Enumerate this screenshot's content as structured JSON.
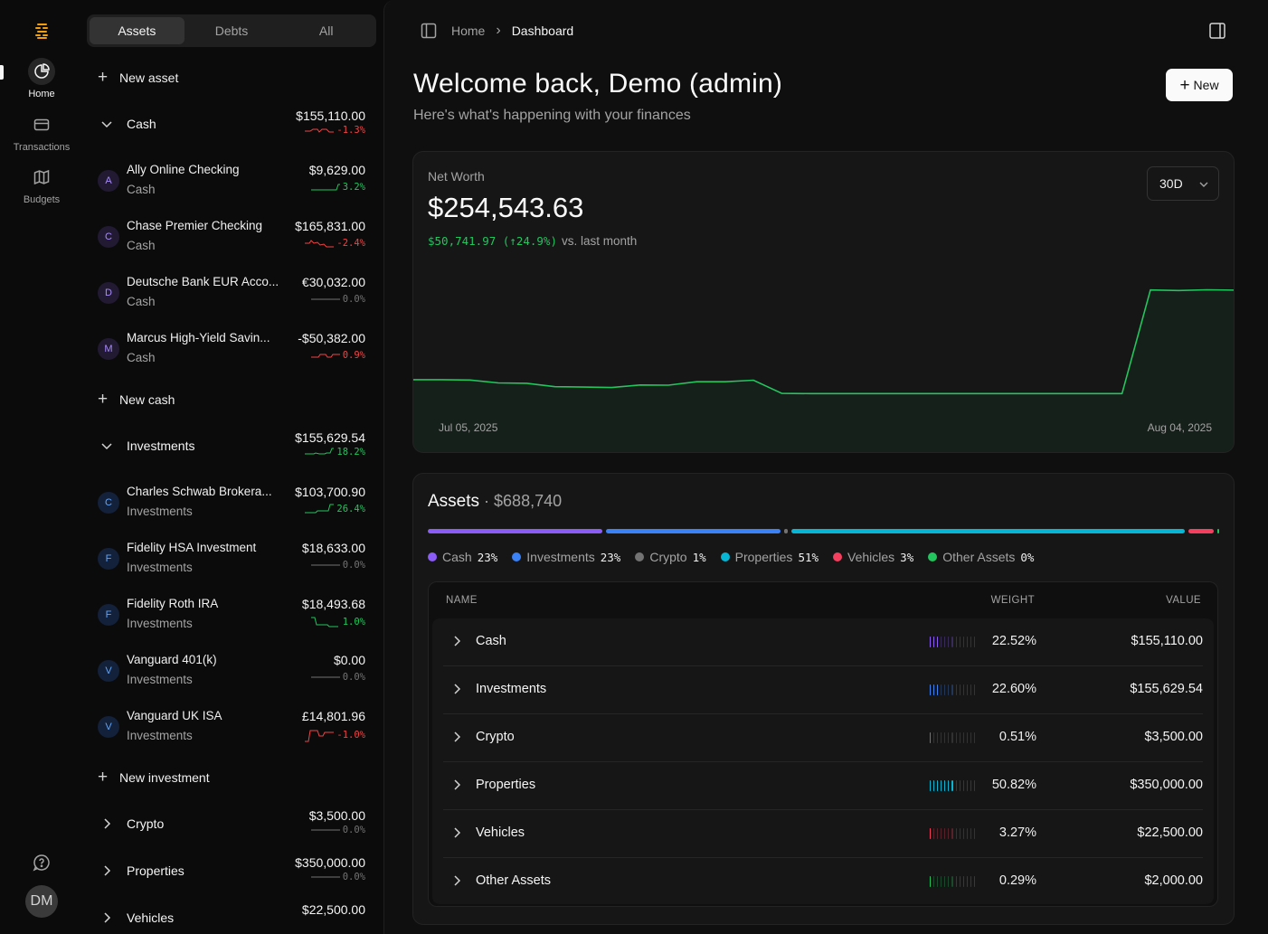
{
  "nav": {
    "items": [
      {
        "label": "Home",
        "icon": "pie-chart-icon",
        "active": true
      },
      {
        "label": "Transactions",
        "icon": "credit-card-icon",
        "active": false
      },
      {
        "label": "Budgets",
        "icon": "map-icon",
        "active": false
      }
    ],
    "user_initials": "DM"
  },
  "sidebar": {
    "tabs": [
      "Assets",
      "Debts",
      "All"
    ],
    "active_tab": "Assets",
    "new_asset": "New asset",
    "groups": {
      "cash": {
        "name": "Cash",
        "amount": "$155,110.00",
        "change": "-1.3%",
        "trend": "neg",
        "accounts": [
          {
            "initial": "A",
            "name": "Ally Online Checking",
            "type": "Cash",
            "amount": "$9,629.00",
            "change": "3.2%",
            "trend": "pos"
          },
          {
            "initial": "C",
            "name": "Chase Premier Checking",
            "type": "Cash",
            "amount": "$165,831.00",
            "change": "-2.4%",
            "trend": "neg"
          },
          {
            "initial": "D",
            "name": "Deutsche Bank EUR Acco...",
            "type": "Cash",
            "amount": "€30,032.00",
            "change": "0.0%",
            "trend": "neu"
          },
          {
            "initial": "M",
            "name": "Marcus High-Yield Savin...",
            "type": "Cash",
            "amount": "-$50,382.00",
            "change": "0.9%",
            "trend": "neg"
          }
        ],
        "add_label": "New cash"
      },
      "investments": {
        "name": "Investments",
        "amount": "$155,629.54",
        "change": "18.2%",
        "trend": "pos",
        "accounts": [
          {
            "initial": "C",
            "name": "Charles Schwab Brokera...",
            "type": "Investments",
            "amount": "$103,700.90",
            "change": "26.4%",
            "trend": "pos"
          },
          {
            "initial": "F",
            "name": "Fidelity HSA Investment",
            "type": "Investments",
            "amount": "$18,633.00",
            "change": "0.0%",
            "trend": "neu"
          },
          {
            "initial": "F",
            "name": "Fidelity Roth IRA",
            "type": "Investments",
            "amount": "$18,493.68",
            "change": "1.0%",
            "trend": "pos"
          },
          {
            "initial": "V",
            "name": "Vanguard 401(k)",
            "type": "Investments",
            "amount": "$0.00",
            "change": "0.0%",
            "trend": "neu"
          },
          {
            "initial": "V",
            "name": "Vanguard UK ISA",
            "type": "Investments",
            "amount": "£14,801.96",
            "change": "-1.0%",
            "trend": "neg"
          }
        ],
        "add_label": "New investment"
      },
      "crypto": {
        "name": "Crypto",
        "amount": "$3,500.00",
        "change": "0.0%",
        "trend": "neu"
      },
      "properties": {
        "name": "Properties",
        "amount": "$350,000.00",
        "change": "0.0%",
        "trend": "neu"
      },
      "vehicles": {
        "name": "Vehicles",
        "amount": "$22,500.00"
      }
    }
  },
  "header": {
    "breadcrumb_home": "Home",
    "breadcrumb_current": "Dashboard",
    "welcome": "Welcome back, Demo (admin)",
    "subtitle": "Here's what's happening with your finances",
    "new_button": "New"
  },
  "net_worth": {
    "label": "Net Worth",
    "value": "$254,543.63",
    "change_text": "$50,741.97 (↑24.9%)",
    "vs_text": "vs. last month",
    "period": "30D",
    "start_date": "Jul 05, 2025",
    "end_date": "Aug 04, 2025",
    "colors": {
      "line": "#22c55e"
    }
  },
  "chart_data": {
    "type": "line",
    "series": [
      {
        "values": [
          204400,
          204400,
          204200,
          202700,
          202500,
          200700,
          200500,
          200300,
          201600,
          201500,
          203300,
          203300,
          204100,
          197200,
          197100,
          197100,
          197100,
          197100,
          197100,
          197100,
          197100,
          197100,
          197100,
          197100,
          197100,
          197100,
          251400,
          251100,
          251500,
          251300
        ]
      }
    ],
    "ylim": [
      180000,
      265000
    ],
    "x_start_label": "Jul 05, 2025",
    "x_end_label": "Aug 04, 2025"
  },
  "assets": {
    "title": "Assets",
    "total": "$688,740",
    "headers": {
      "name": "NAME",
      "weight": "WEIGHT",
      "value": "VALUE"
    },
    "categories": [
      {
        "name": "Cash",
        "pct": "23%",
        "weight": "22.52%",
        "share": 0.2252,
        "value": "$155,110.00",
        "color": "#8b5cf6"
      },
      {
        "name": "Investments",
        "pct": "23%",
        "weight": "22.60%",
        "share": 0.226,
        "value": "$155,629.54",
        "color": "#3b82f6"
      },
      {
        "name": "Crypto",
        "pct": "1%",
        "weight": "0.51%",
        "share": 0.0051,
        "value": "$3,500.00",
        "color": "#737373"
      },
      {
        "name": "Properties",
        "pct": "51%",
        "weight": "50.82%",
        "share": 0.5082,
        "value": "$350,000.00",
        "color": "#06b6d4"
      },
      {
        "name": "Vehicles",
        "pct": "3%",
        "weight": "3.27%",
        "share": 0.0327,
        "value": "$22,500.00",
        "color": "#f43f5e"
      },
      {
        "name": "Other Assets",
        "pct": "0%",
        "weight": "0.29%",
        "share": 0.0029,
        "value": "$2,000.00",
        "color": "#22c55e"
      }
    ]
  }
}
